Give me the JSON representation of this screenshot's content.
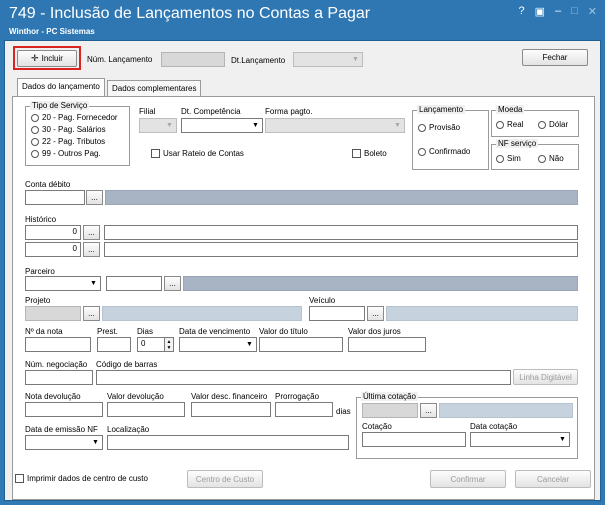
{
  "window": {
    "title": "749 - Inclusão de Lançamentos no Contas a Pagar",
    "subtitle": "Winthor - PC Sistemas",
    "ctrl_help": "?",
    "ctrl_restore": "▣",
    "ctrl_min": "–",
    "ctrl_max": "□",
    "ctrl_close": "✕"
  },
  "toolbar": {
    "incluir": "Incluir",
    "num_lancamento_label": "Núm. Lançamento",
    "dt_lancamento_label": "Dt.Lançamento",
    "fechar": "Fechar"
  },
  "tabs": [
    "Dados do lançamento",
    "Dados complementares"
  ],
  "tipo_servico": {
    "label": "Tipo de Serviço",
    "options": [
      "20 - Pag. Fornecedor",
      "30 - Pag. Salários",
      "22 - Pag. Tributos",
      "99 - Outros Pag."
    ]
  },
  "fields": {
    "filial": "Filial",
    "dt_competencia": "Dt. Competência",
    "forma_pagto": "Forma pagto.",
    "usar_rateio": "Usar Rateio de Contas",
    "boleto": "Boleto",
    "conta_debito": "Conta débito",
    "historico": "Histórico",
    "historico_val1": "0",
    "historico_val2": "0",
    "parceiro": "Parceiro",
    "projeto": "Projeto",
    "veiculo": "Veículo",
    "num_nota": "Nº da nota",
    "prest": "Prest.",
    "dias": "Dias",
    "dias_val": "0",
    "data_vencimento": "Data de vencimento",
    "valor_titulo": "Valor do título",
    "valor_juros": "Valor dos juros",
    "num_negociacao": "Núm. negociação",
    "codigo_barras": "Código de barras",
    "linha_digitavel": "Linha Digitável",
    "nota_devolucao": "Nota devolução",
    "valor_devolucao": "Valor devolução",
    "valor_desc_financeiro": "Valor desc. financeiro",
    "prorrogacao": "Prorrogação",
    "dias_suffix": "dias",
    "ultima_cotacao": "Última cotação",
    "cotacao": "Cotação",
    "data_cotacao": "Data cotação",
    "data_emissao_nf": "Data de emissão NF",
    "localizacao": "Localização",
    "ellipsis": "..."
  },
  "lancamento": {
    "label": "Lançamento",
    "options": [
      "Provisão",
      "Confirmado"
    ]
  },
  "moeda": {
    "label": "Moeda",
    "options": [
      "Real",
      "Dólar"
    ]
  },
  "nf_servico": {
    "label": "NF serviço",
    "options": [
      "Sim",
      "Não"
    ]
  },
  "footer": {
    "imprimir": "Imprimir dados de centro de custo",
    "centro_custo": "Centro de Custo",
    "confirmar": "Confirmar",
    "cancelar": "Cancelar"
  }
}
